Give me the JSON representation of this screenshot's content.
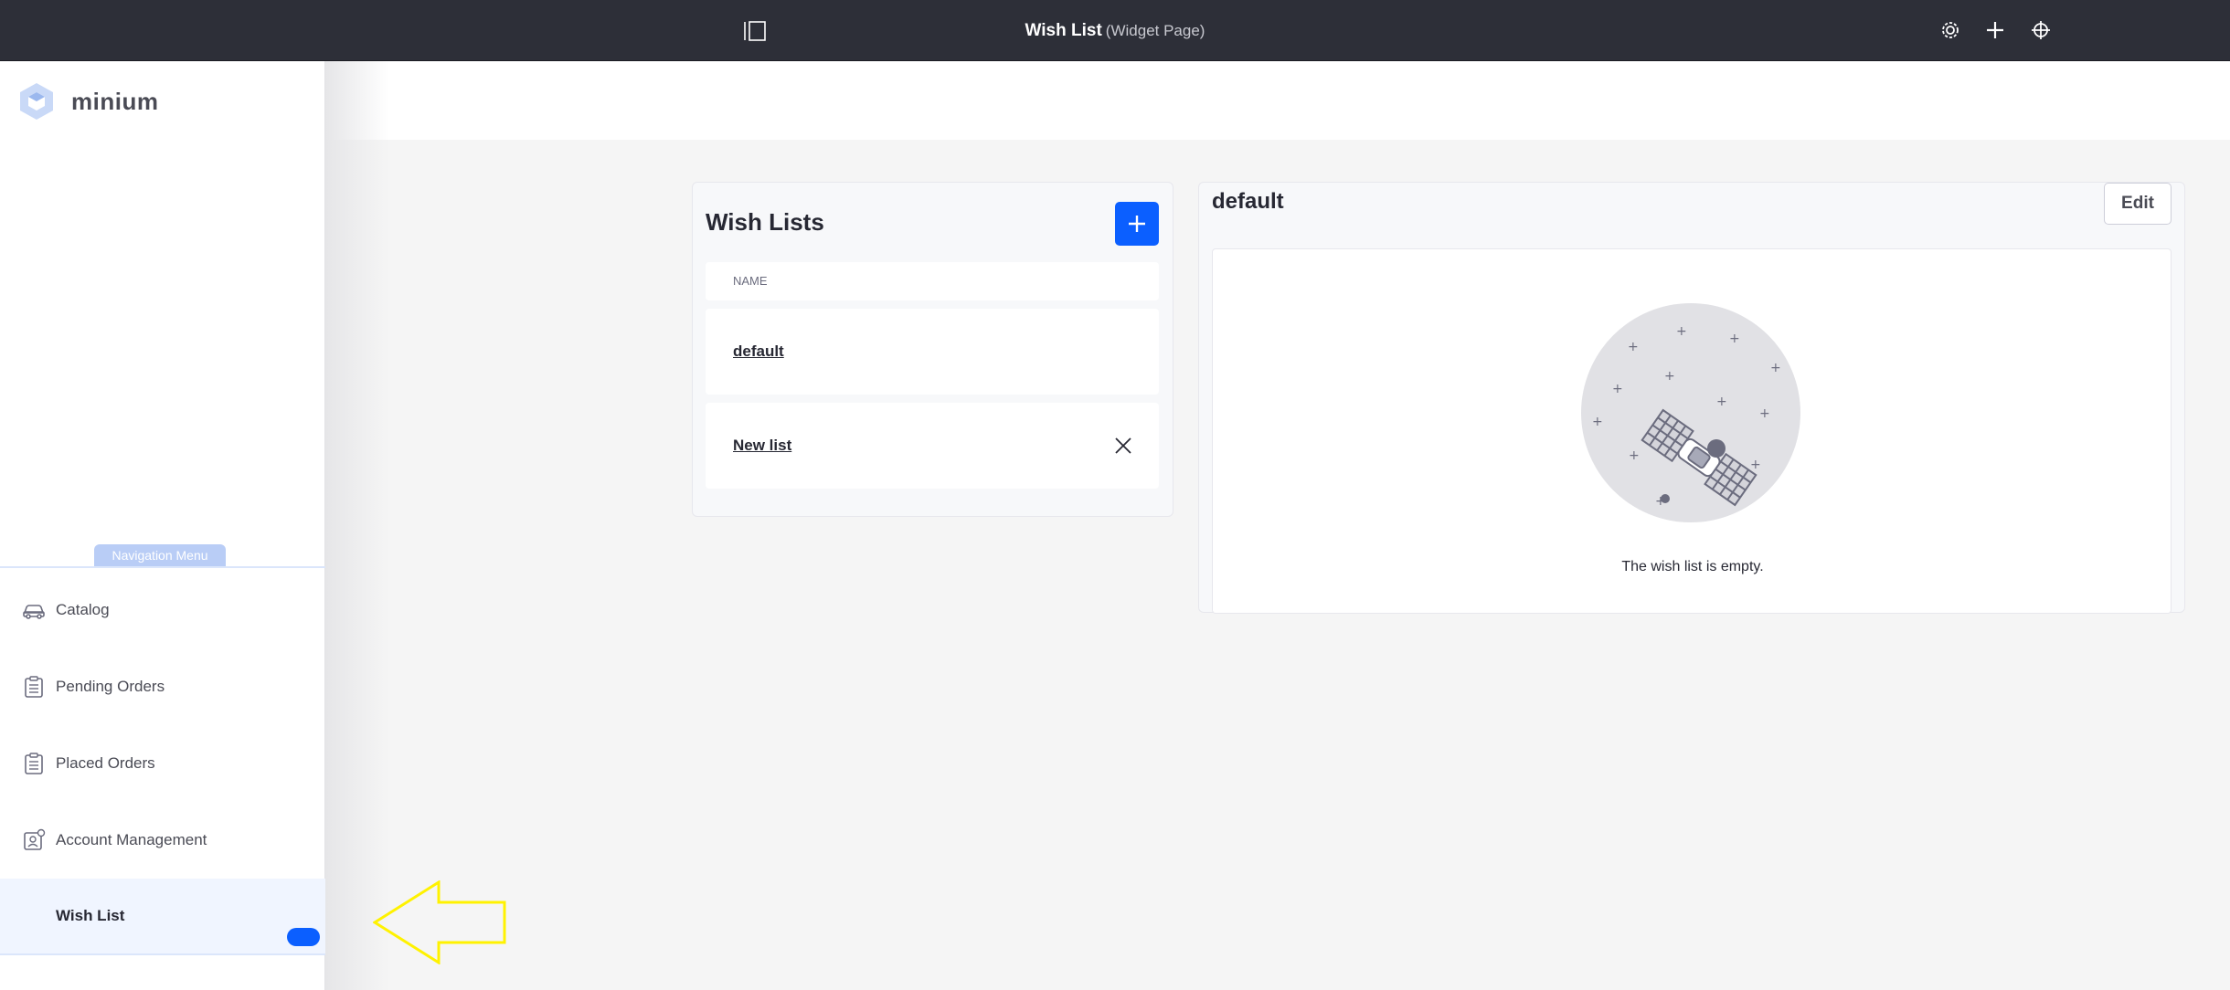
{
  "topbar": {
    "page_name": "Wish List",
    "page_type": "(Widget Page)",
    "bg_color": "#2d2f38",
    "panel_toggle_icon": "sidebar-panel-icon",
    "buttons": [
      "gear-icon",
      "plus-icon",
      "simulation-icon"
    ]
  },
  "brand": {
    "name": "minium",
    "logo_icon": "hexagon-cube-icon"
  },
  "nav": {
    "tag": "Navigation Menu",
    "items": [
      {
        "label": "Catalog",
        "icon": "car-icon"
      },
      {
        "label": "Pending Orders",
        "icon": "clipboard-list-icon"
      },
      {
        "label": "Placed Orders",
        "icon": "clipboard-list-icon"
      },
      {
        "label": "Account Management",
        "icon": "account-settings-icon"
      },
      {
        "label": "Wish List",
        "icon": "",
        "active": true
      }
    ]
  },
  "wish_lists": {
    "title": "Wish Lists",
    "add_icon": "plus-icon",
    "column_header": "Name",
    "rows": [
      {
        "name": "default",
        "deletable": false
      },
      {
        "name": "New list",
        "deletable": true
      }
    ]
  },
  "detail": {
    "title": "default",
    "edit_label": "Edit",
    "empty_message": "The wish list is empty.",
    "empty_icon": "satellite-illustration"
  },
  "colors": {
    "accent": "#0b5fff",
    "pointer_arrow": "#fff200"
  }
}
